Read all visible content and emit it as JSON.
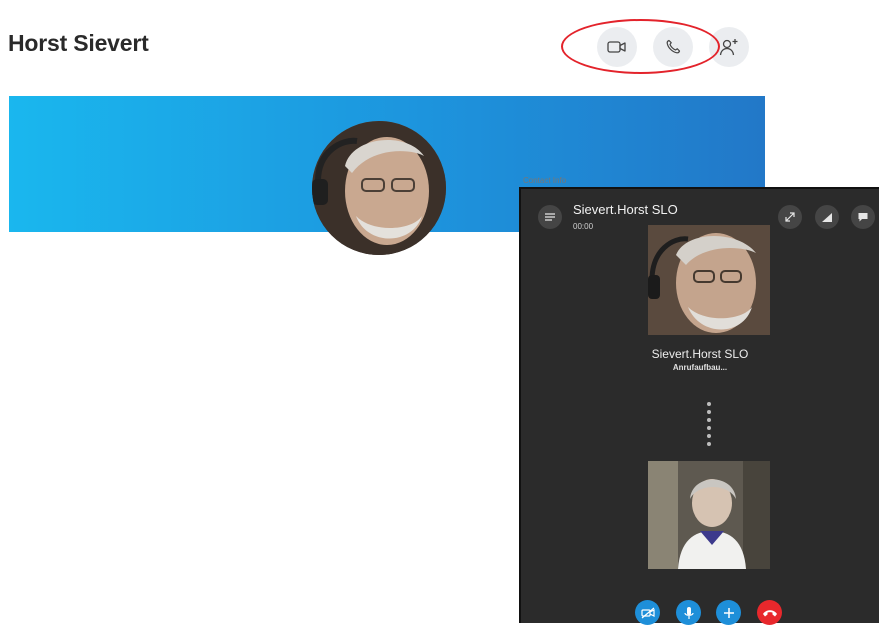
{
  "profile": {
    "name": "Horst Sievert",
    "peek_text": "Contact   Info"
  },
  "call": {
    "title": "Sievert.Horst SLO",
    "timer": "00:00",
    "participant_name": "Sievert.Horst SLO",
    "status": "Anrufaufbau..."
  },
  "icons": {
    "video_call": "video-camera-icon",
    "audio_call": "phone-icon",
    "add_contact": "add-person-icon",
    "menu": "menu-icon",
    "expand": "expand-icon",
    "signal": "signal-icon",
    "chat": "chat-icon",
    "video_toggle": "video-off-icon",
    "mic": "microphone-icon",
    "add": "plus-icon",
    "hangup": "hang-up-icon"
  },
  "colors": {
    "banner_start": "#1ab7ee",
    "banner_end": "#2278c8",
    "highlight_ring": "#e3232b",
    "call_bg": "#2b2b2b",
    "control_blue": "#1e8fd9",
    "hangup_red": "#e8282c"
  }
}
